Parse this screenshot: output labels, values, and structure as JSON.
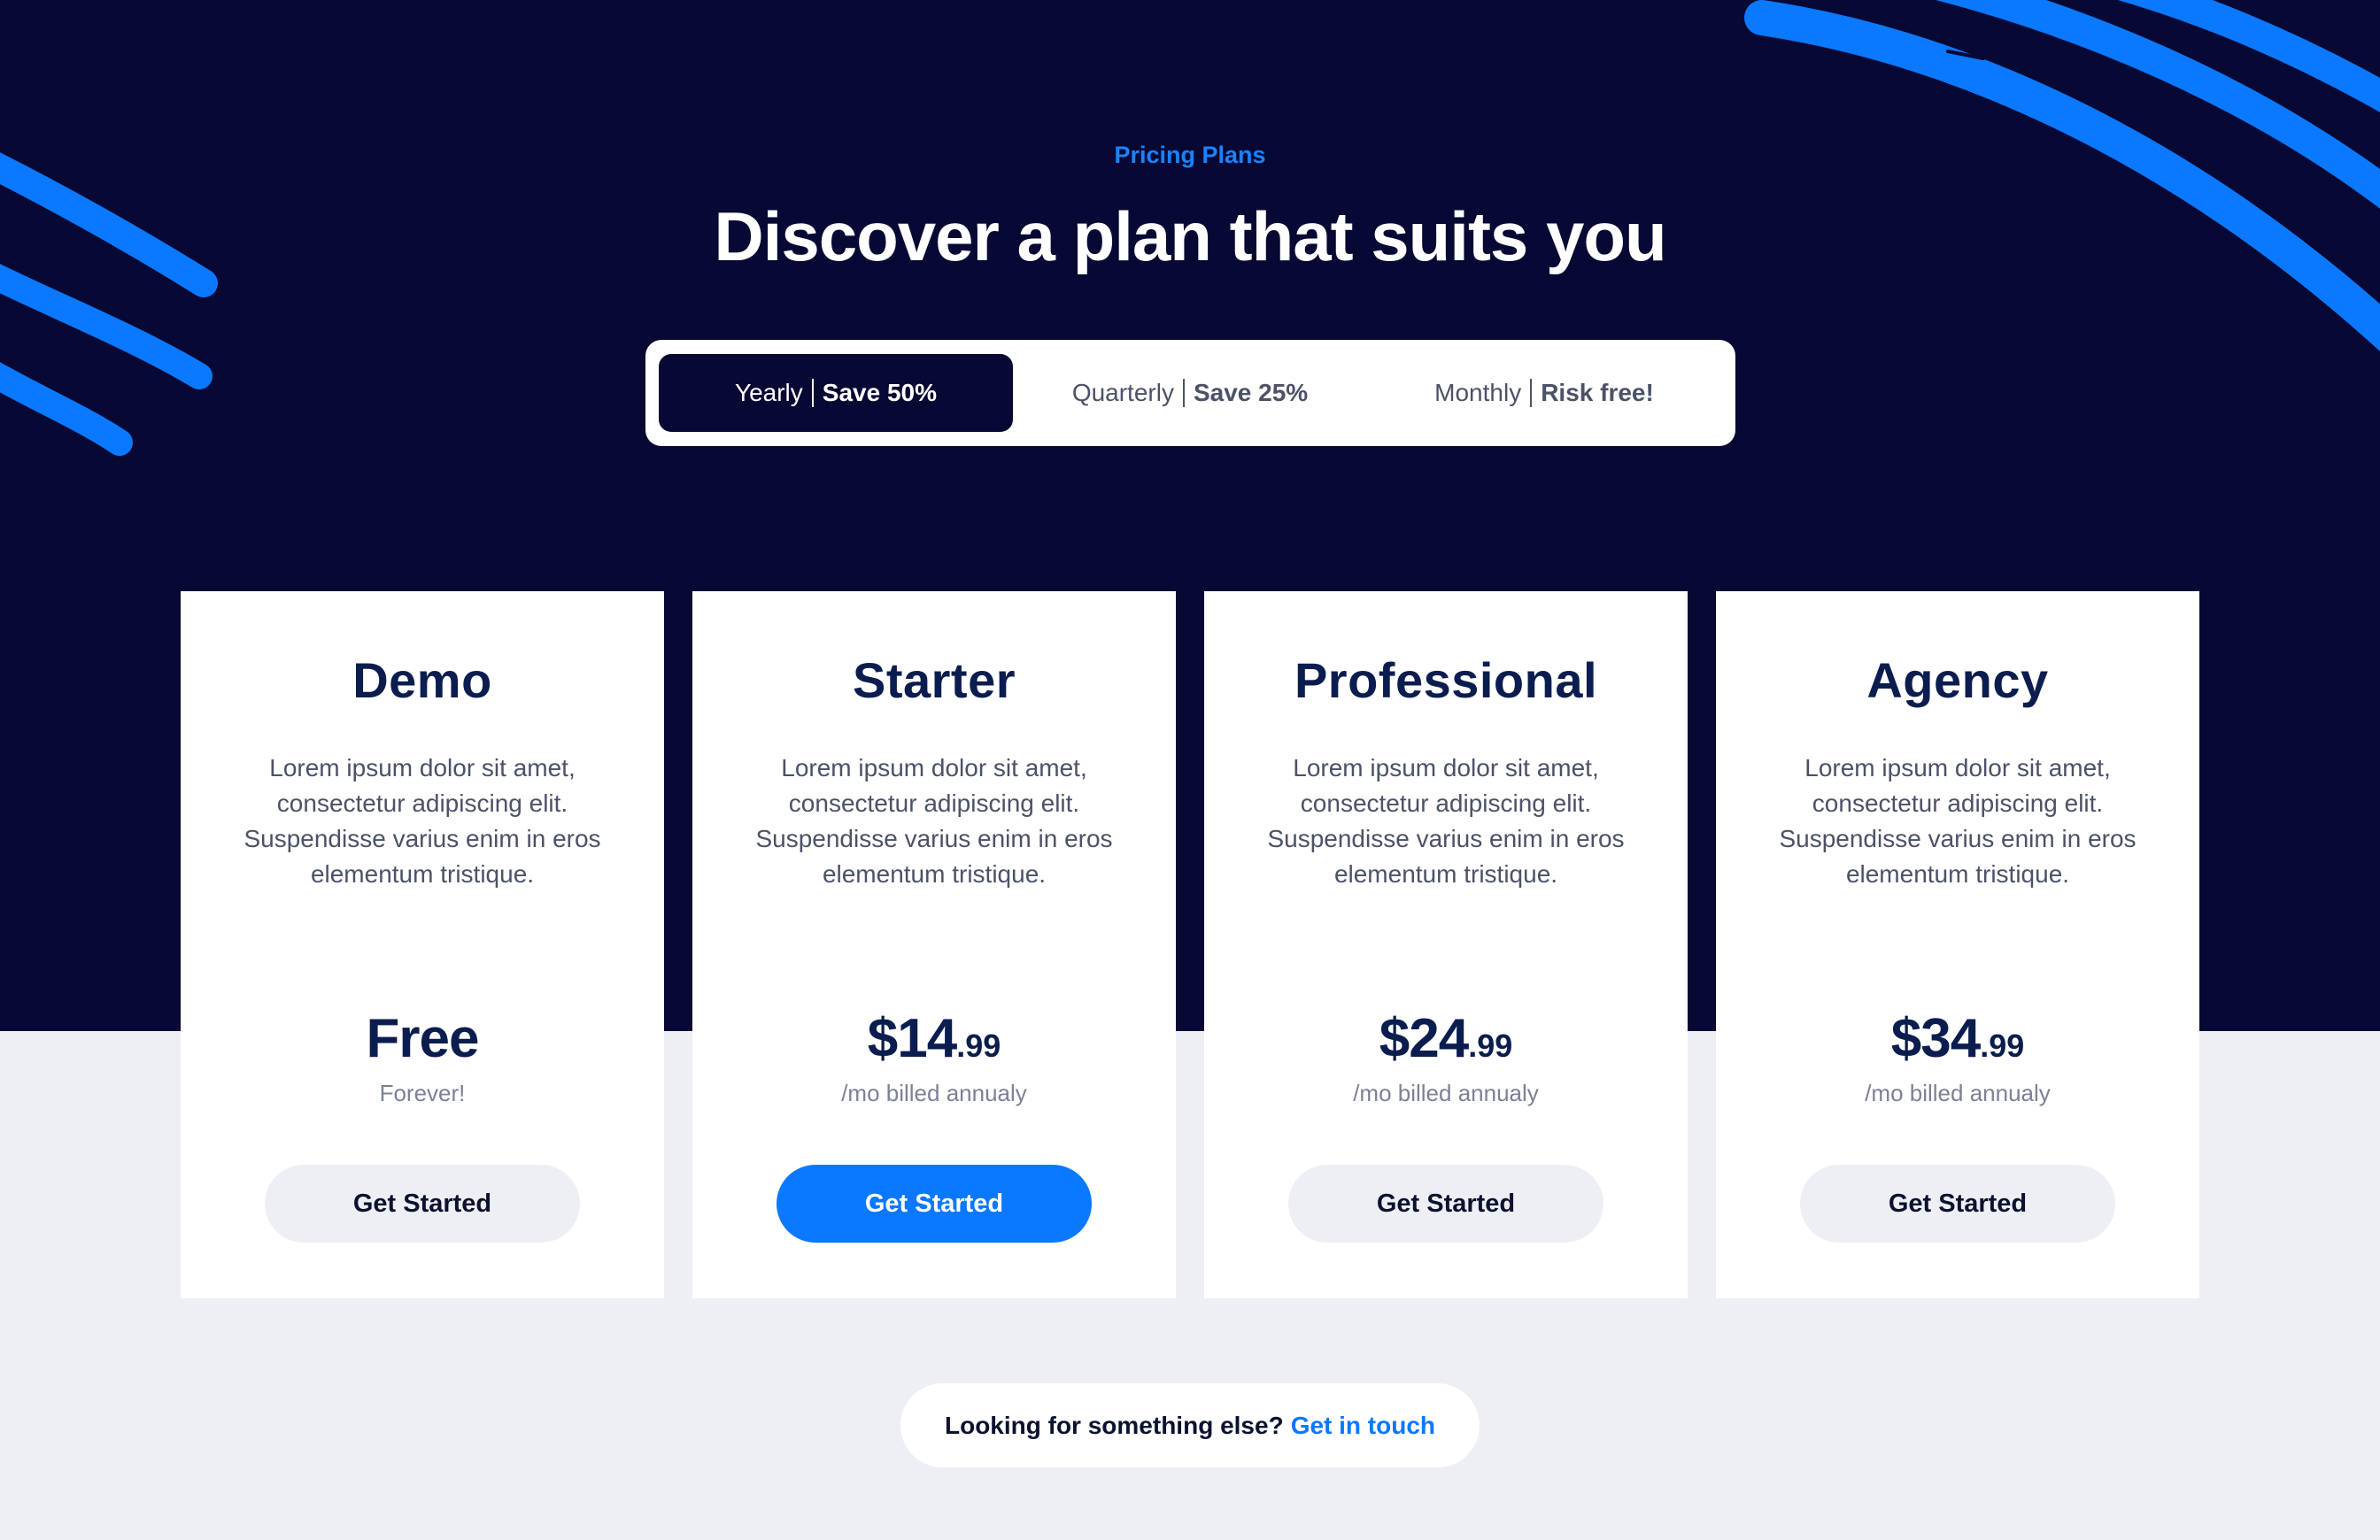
{
  "header": {
    "eyebrow": "Pricing Plans",
    "title": "Discover a plan that suits you"
  },
  "billing_toggle": {
    "selected": "Yearly",
    "options": [
      {
        "period": "Yearly",
        "deal": "Save 50%"
      },
      {
        "period": "Quarterly",
        "deal": "Save 25%"
      },
      {
        "period": "Monthly",
        "deal": "Risk free!"
      }
    ]
  },
  "plans": [
    {
      "name": "Demo",
      "description": "Lorem ipsum dolor sit amet, consectetur adipiscing elit. Suspendisse varius enim in eros elementum tristique.",
      "price_main": "Free",
      "price_cents": "",
      "note": "Forever!",
      "cta": "Get Started"
    },
    {
      "name": "Starter",
      "description": "Lorem ipsum dolor sit amet, consectetur adipiscing elit. Suspendisse varius enim in eros elementum tristique.",
      "price_main": "$14",
      "price_cents": ".99",
      "note": "/mo billed annualy",
      "cta": "Get Started"
    },
    {
      "name": "Professional",
      "description": "Lorem ipsum dolor sit amet, consectetur adipiscing elit. Suspendisse varius enim in eros elementum tristique.",
      "price_main": "$24",
      "price_cents": ".99",
      "note": "/mo billed annualy",
      "cta": "Get Started"
    },
    {
      "name": "Agency",
      "description": "Lorem ipsum dolor sit amet, consectetur adipiscing elit. Suspendisse varius enim in eros elementum tristique.",
      "price_main": "$34",
      "price_cents": ".99",
      "note": "/mo billed annualy",
      "cta": "Get Started"
    }
  ],
  "footer_cta": {
    "text": "Looking for something else?",
    "link": "Get in touch"
  },
  "colors": {
    "hero_bg": "#070934",
    "accent": "#0a78ff",
    "page_bg": "#eeeff4",
    "heading": "#0b1d4f"
  }
}
